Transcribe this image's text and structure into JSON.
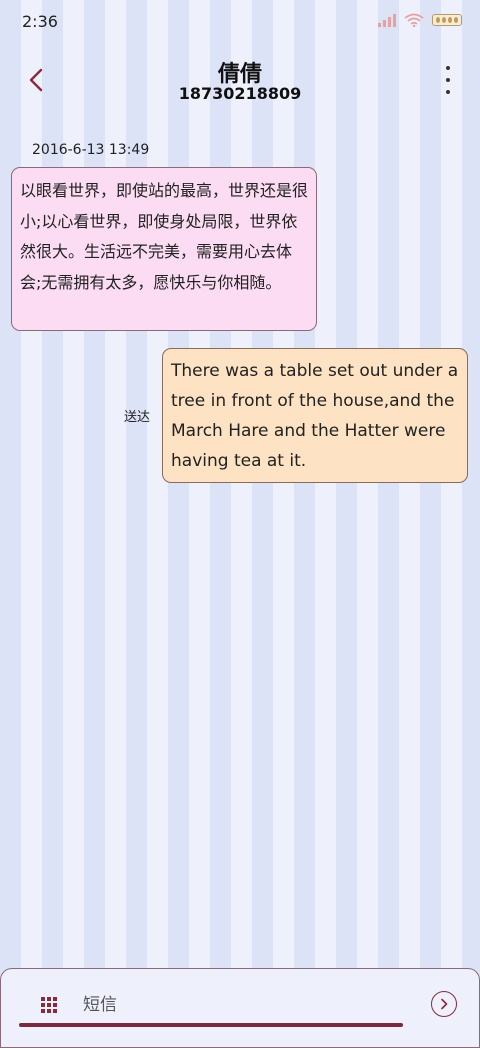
{
  "status_bar": {
    "time": "2:36",
    "icons": [
      "signal-icon",
      "wifi-icon",
      "battery-icon"
    ]
  },
  "header": {
    "contact_name": "倩倩",
    "contact_number": "18730218809",
    "back_icon": "chevron-left-icon",
    "more_icon": "more-vertical-icon"
  },
  "conversation": {
    "timestamp": "2016-6-13 13:49",
    "messages": [
      {
        "direction": "incoming",
        "text": "以眼看世界，即使站的最高，世界还是很小;以心看世界，即使身处局限，世界依然很大。生活远不完美，需要用心去体会;无需拥有太多，愿快乐与你相随。"
      },
      {
        "direction": "outgoing",
        "status": "送达",
        "text": "There was a table set out under a tree in front of the house,and the March Hare and the Hatter were having tea at it."
      }
    ]
  },
  "composer": {
    "placeholder": "短信",
    "value": "",
    "apps_icon": "grid-icon",
    "send_icon": "send-arrow-icon"
  },
  "colors": {
    "accent": "#8a2a3a",
    "incoming_bubble": "#fbdcf2",
    "outgoing_bubble": "#fde3c4",
    "stripe_dark": "#dde3f7",
    "stripe_light": "#eef1fb"
  }
}
